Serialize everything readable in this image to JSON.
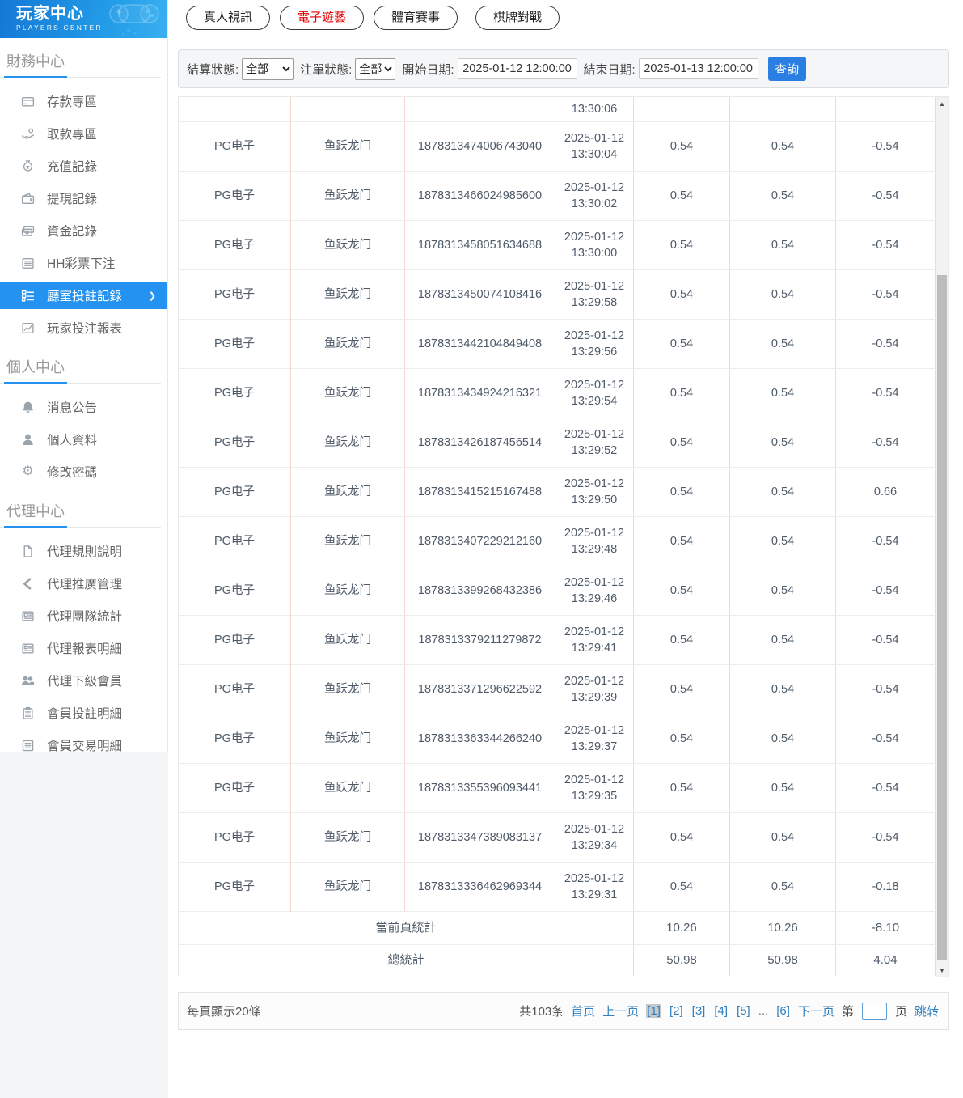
{
  "colors": {
    "accent": "#2492f0",
    "link": "#2f7fc1",
    "tab_active_red": "#e60000",
    "button_blue": "#2b7fe3",
    "table_divider_pink": "#f7d5d3"
  },
  "brand": {
    "title": "玩家中心",
    "subtitle": "PLAYERS CENTER"
  },
  "sidebar": {
    "sections": [
      {
        "title": "財務中心",
        "items": [
          {
            "key": "deposit-zone",
            "label": "存款專區",
            "icon": "deposit-card-icon",
            "active": false
          },
          {
            "key": "withdraw-zone",
            "label": "取款專區",
            "icon": "withdraw-hand-icon",
            "active": false
          },
          {
            "key": "recharge-records",
            "label": "充值記錄",
            "icon": "money-bag-icon",
            "active": false
          },
          {
            "key": "withdrawal-records",
            "label": "提現記錄",
            "icon": "wallet-icon",
            "active": false
          },
          {
            "key": "funds-records",
            "label": "資金記錄",
            "icon": "banknotes-icon",
            "active": false
          },
          {
            "key": "hh-lottery-bets",
            "label": "HH彩票下注",
            "icon": "lottery-list-icon",
            "active": false
          },
          {
            "key": "room-bet-records",
            "label": "廳室投註記錄",
            "icon": "room-bet-list-icon",
            "active": true
          },
          {
            "key": "player-bet-report",
            "label": "玩家投注報表",
            "icon": "report-chart-icon",
            "active": false
          }
        ]
      },
      {
        "title": "個人中心",
        "items": [
          {
            "key": "notices",
            "label": "消息公告",
            "icon": "bell-icon",
            "active": false
          },
          {
            "key": "profile",
            "label": "個人資料",
            "icon": "person-icon",
            "active": false
          },
          {
            "key": "change-password",
            "label": "修改密碼",
            "icon": "gear-icon",
            "active": false
          }
        ]
      },
      {
        "title": "代理中心",
        "items": [
          {
            "key": "agent-rules",
            "label": "代理規則說明",
            "icon": "document-icon",
            "active": false
          },
          {
            "key": "agent-promotion",
            "label": "代理推廣管理",
            "icon": "share-icon",
            "active": false
          },
          {
            "key": "agent-team-stats",
            "label": "代理團隊統計",
            "icon": "news-report-icon",
            "active": false
          },
          {
            "key": "agent-report-detail",
            "label": "代理報表明細",
            "icon": "news-report2-icon",
            "active": false
          },
          {
            "key": "agent-sub-members",
            "label": "代理下級會員",
            "icon": "users-icon",
            "active": false
          },
          {
            "key": "member-bet-detail",
            "label": "會員投註明細",
            "icon": "clipboard-list-icon",
            "active": false
          },
          {
            "key": "member-trade-detail",
            "label": "會員交易明細",
            "icon": "list-box-icon",
            "active": false
          }
        ]
      }
    ]
  },
  "tabs": [
    {
      "label": "真人視訊",
      "active": false
    },
    {
      "label": "電子遊藝",
      "active": true
    },
    {
      "label": "體育賽事",
      "active": false
    },
    {
      "label": "棋牌對戰",
      "active": false
    }
  ],
  "filters": {
    "settle_status_label": "結算狀態:",
    "settle_status_value": "全部",
    "order_status_label": "注單狀態:",
    "order_status_value": "全部",
    "start_label": "開始日期:",
    "start_value": "2025-01-12 12:00:00",
    "end_label": "結束日期:",
    "end_value": "2025-01-13 12:00:00",
    "search_label": "查詢"
  },
  "table": {
    "partial_row_time": "13:30:06",
    "rows": [
      {
        "platform": "PG电子",
        "game": "鱼跃龙门",
        "order_id": "1878313474006743040",
        "date": "2025-01-12",
        "time": "13:30:04",
        "bet": "0.54",
        "valid_bet": "0.54",
        "profit": "-0.54"
      },
      {
        "platform": "PG电子",
        "game": "鱼跃龙门",
        "order_id": "1878313466024985600",
        "date": "2025-01-12",
        "time": "13:30:02",
        "bet": "0.54",
        "valid_bet": "0.54",
        "profit": "-0.54"
      },
      {
        "platform": "PG电子",
        "game": "鱼跃龙门",
        "order_id": "1878313458051634688",
        "date": "2025-01-12",
        "time": "13:30:00",
        "bet": "0.54",
        "valid_bet": "0.54",
        "profit": "-0.54"
      },
      {
        "platform": "PG电子",
        "game": "鱼跃龙门",
        "order_id": "1878313450074108416",
        "date": "2025-01-12",
        "time": "13:29:58",
        "bet": "0.54",
        "valid_bet": "0.54",
        "profit": "-0.54"
      },
      {
        "platform": "PG电子",
        "game": "鱼跃龙门",
        "order_id": "1878313442104849408",
        "date": "2025-01-12",
        "time": "13:29:56",
        "bet": "0.54",
        "valid_bet": "0.54",
        "profit": "-0.54"
      },
      {
        "platform": "PG电子",
        "game": "鱼跃龙门",
        "order_id": "1878313434924216321",
        "date": "2025-01-12",
        "time": "13:29:54",
        "bet": "0.54",
        "valid_bet": "0.54",
        "profit": "-0.54"
      },
      {
        "platform": "PG电子",
        "game": "鱼跃龙门",
        "order_id": "1878313426187456514",
        "date": "2025-01-12",
        "time": "13:29:52",
        "bet": "0.54",
        "valid_bet": "0.54",
        "profit": "-0.54"
      },
      {
        "platform": "PG电子",
        "game": "鱼跃龙门",
        "order_id": "1878313415215167488",
        "date": "2025-01-12",
        "time": "13:29:50",
        "bet": "0.54",
        "valid_bet": "0.54",
        "profit": "0.66"
      },
      {
        "platform": "PG电子",
        "game": "鱼跃龙门",
        "order_id": "1878313407229212160",
        "date": "2025-01-12",
        "time": "13:29:48",
        "bet": "0.54",
        "valid_bet": "0.54",
        "profit": "-0.54"
      },
      {
        "platform": "PG电子",
        "game": "鱼跃龙门",
        "order_id": "1878313399268432386",
        "date": "2025-01-12",
        "time": "13:29:46",
        "bet": "0.54",
        "valid_bet": "0.54",
        "profit": "-0.54"
      },
      {
        "platform": "PG电子",
        "game": "鱼跃龙门",
        "order_id": "1878313379211279872",
        "date": "2025-01-12",
        "time": "13:29:41",
        "bet": "0.54",
        "valid_bet": "0.54",
        "profit": "-0.54"
      },
      {
        "platform": "PG电子",
        "game": "鱼跃龙门",
        "order_id": "1878313371296622592",
        "date": "2025-01-12",
        "time": "13:29:39",
        "bet": "0.54",
        "valid_bet": "0.54",
        "profit": "-0.54"
      },
      {
        "platform": "PG电子",
        "game": "鱼跃龙门",
        "order_id": "1878313363344266240",
        "date": "2025-01-12",
        "time": "13:29:37",
        "bet": "0.54",
        "valid_bet": "0.54",
        "profit": "-0.54"
      },
      {
        "platform": "PG电子",
        "game": "鱼跃龙门",
        "order_id": "1878313355396093441",
        "date": "2025-01-12",
        "time": "13:29:35",
        "bet": "0.54",
        "valid_bet": "0.54",
        "profit": "-0.54"
      },
      {
        "platform": "PG电子",
        "game": "鱼跃龙门",
        "order_id": "1878313347389083137",
        "date": "2025-01-12",
        "time": "13:29:34",
        "bet": "0.54",
        "valid_bet": "0.54",
        "profit": "-0.54"
      },
      {
        "platform": "PG电子",
        "game": "鱼跃龙门",
        "order_id": "1878313336462969344",
        "date": "2025-01-12",
        "time": "13:29:31",
        "bet": "0.54",
        "valid_bet": "0.54",
        "profit": "-0.18"
      }
    ],
    "page_summary": {
      "label": "當前頁統計",
      "bet": "10.26",
      "valid_bet": "10.26",
      "profit": "-8.10"
    },
    "total_summary": {
      "label": "總統計",
      "bet": "50.98",
      "valid_bet": "50.98",
      "profit": "4.04"
    }
  },
  "pagination": {
    "page_size_text": "每頁顯示20條",
    "total_text": "共103条",
    "first": "首页",
    "prev": "上一页",
    "pages_before": [
      "1",
      "2",
      "3",
      "4",
      "5"
    ],
    "ellipsis": "...",
    "pages_after": [
      "6"
    ],
    "next": "下一页",
    "current_page": "1",
    "jump_prefix": "第",
    "jump_suffix": "页",
    "jump_button": "跳转",
    "jump_value": ""
  }
}
